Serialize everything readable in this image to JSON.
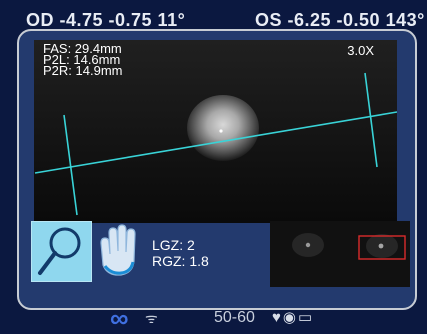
{
  "background": {
    "od_label": "OD -4.75 -0.75 11°",
    "os_label": "OS -6.25 -0.50 143°",
    "range_label": "50-60"
  },
  "measurements": {
    "fas": "FAS: 29.4mm",
    "p2l": "P2L: 14.6mm",
    "p2r": "P2R: 14.9mm"
  },
  "zoom_level": "3.0X",
  "zoom_values": {
    "lgz": "LGZ: 2",
    "rgz": "RGZ: 1.8"
  },
  "colors": {
    "accent_cyan": "#39d3d7",
    "selected_tool_bg": "#8fd7ee",
    "panel_bg": "#233a6e",
    "selection_box": "#d92b2b"
  },
  "icons": {
    "zoom_tool": "magnifier-icon",
    "pan_tool": "hand-icon"
  }
}
